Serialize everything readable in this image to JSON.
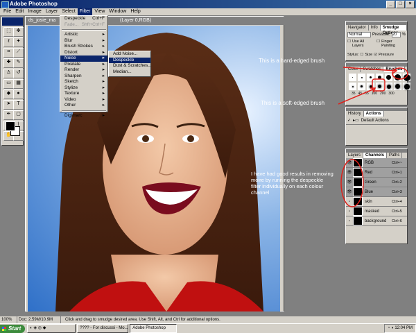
{
  "app": {
    "title": "Adobe Photoshop"
  },
  "menubar": [
    "File",
    "Edit",
    "Image",
    "Layer",
    "Select",
    "Filter",
    "View",
    "Window",
    "Help"
  ],
  "document": {
    "title_left": "ds_josie_ma",
    "title_right": "(Layer 0,RGB)",
    "zoom": "100%"
  },
  "filter_menu": [
    {
      "label": "Despeckle",
      "shortcut": "Ctrl+F"
    },
    {
      "label": "Fade...",
      "shortcut": "Shft+Ctrl+F",
      "disabled": true
    },
    {
      "sep": true
    },
    {
      "label": "Artistic",
      "sub": true
    },
    {
      "label": "Blur",
      "sub": true
    },
    {
      "label": "Brush Strokes",
      "sub": true
    },
    {
      "label": "Distort",
      "sub": true
    },
    {
      "label": "Noise",
      "sub": true,
      "highlight": true
    },
    {
      "label": "Pixelate",
      "sub": true
    },
    {
      "label": "Render",
      "sub": true
    },
    {
      "label": "Sharpen",
      "sub": true
    },
    {
      "label": "Sketch",
      "sub": true
    },
    {
      "label": "Stylize",
      "sub": true
    },
    {
      "label": "Texture",
      "sub": true
    },
    {
      "label": "Video",
      "sub": true
    },
    {
      "label": "Other",
      "sub": true
    },
    {
      "sep": true
    },
    {
      "label": "Digimarc",
      "sub": true
    }
  ],
  "noise_submenu": [
    {
      "label": "Add Noise..."
    },
    {
      "label": "Despeckle",
      "highlight": true
    },
    {
      "label": "Dust & Scratches..."
    },
    {
      "label": "Median..."
    }
  ],
  "options_panel": {
    "tabs": [
      "Navigator",
      "Info",
      "Smudge Options"
    ],
    "mode": "Normal",
    "pressure_label": "Pressure:",
    "pressure_value": "20",
    "pressure_unit": "%",
    "use_all_layers": "Use All Layers",
    "finger_painting": "Finger Painting",
    "stylus_label": "Stylus:",
    "size": "Size",
    "pressure": "Pressure"
  },
  "brushes_panel": {
    "tabs": [
      "Color",
      "Swatches",
      "Brushes"
    ],
    "sizes": [
      "35",
      "45",
      "65",
      "100",
      "200",
      "300"
    ]
  },
  "history_panel": {
    "tabs": [
      "History",
      "Actions"
    ],
    "item": "Default Actions"
  },
  "channels_panel": {
    "tabs": [
      "Layers",
      "Channels",
      "Paths"
    ],
    "rows": [
      {
        "name": "RGB",
        "shortcut": "Ctrl+~",
        "visible": true,
        "selected": true
      },
      {
        "name": "Red",
        "shortcut": "Ctrl+1",
        "visible": true,
        "selected": true
      },
      {
        "name": "Green",
        "shortcut": "Ctrl+2",
        "visible": true,
        "selected": true
      },
      {
        "name": "Blue",
        "shortcut": "Ctrl+3",
        "visible": true,
        "selected": true
      },
      {
        "name": "skin",
        "shortcut": "Ctrl+4",
        "visible": false,
        "selected": false
      },
      {
        "name": "masked",
        "shortcut": "Ctrl+5",
        "visible": false,
        "selected": false
      },
      {
        "name": "background",
        "shortcut": "Ctrl+6",
        "visible": false,
        "selected": false
      }
    ]
  },
  "annotations": {
    "hard": "This is a hard-edged brush",
    "soft": "This is a soft-edged brush",
    "note": "I have had good results in removing moire by running the despeckle filter individually on each colour channel"
  },
  "statusbar": {
    "zoom": "100%",
    "doc": "Doc: 2.59M/10.9M",
    "hint": "Click and drag to smudge desired area. Use Shift, Alt, and Ctrl for additional options."
  },
  "taskbar": {
    "start": "Start",
    "tasks": [
      "???? - For discussi - Mo...",
      "Adobe Photoshop"
    ],
    "clock": "12:04 PM"
  },
  "colors": {
    "annotation_red": "#e0201b",
    "title_blue": "#0a246a"
  }
}
